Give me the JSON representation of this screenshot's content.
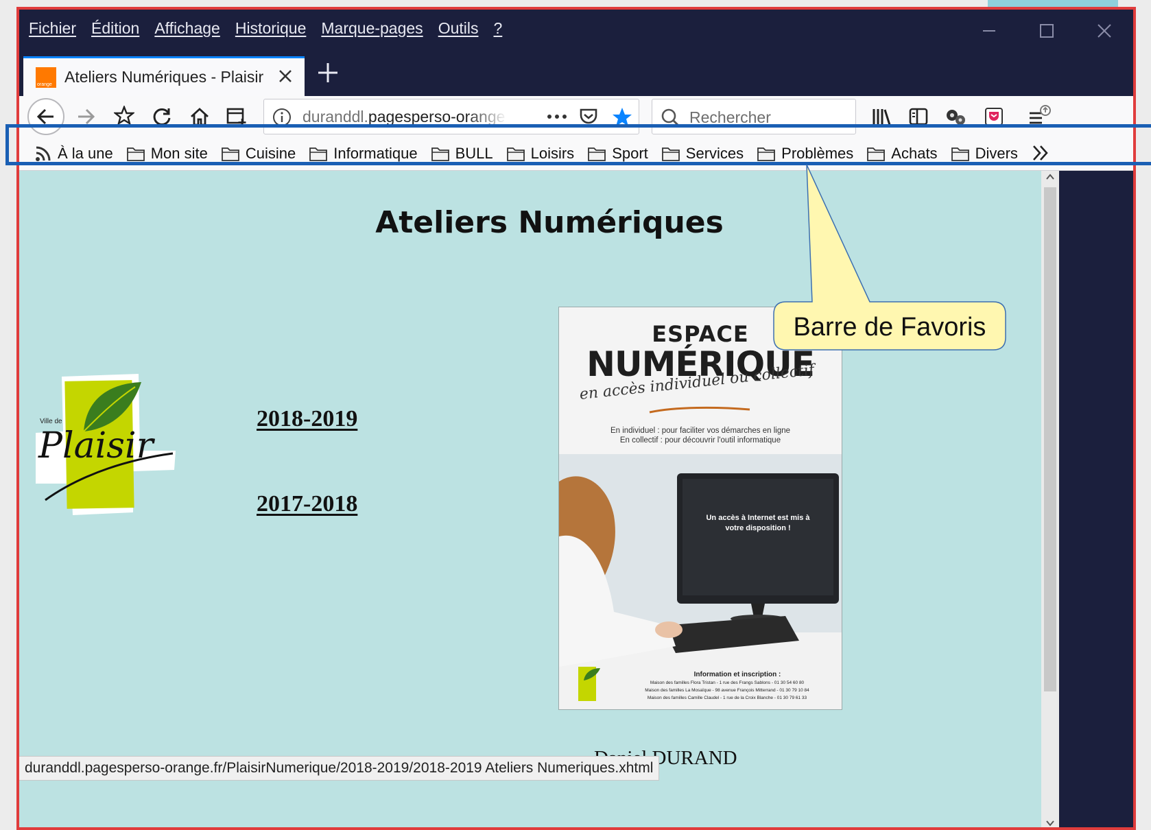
{
  "menu": {
    "items": [
      "Fichier",
      "Édition",
      "Affichage",
      "Historique",
      "Marque-pages",
      "Outils",
      "?"
    ]
  },
  "tab": {
    "title": "Ateliers Numériques - Plaisir",
    "favicon_label": "orange"
  },
  "toolbar": {
    "url_prefix": "duranddl.",
    "url_domain": "pagesperso-orange.fr/PlaisirNumerique/",
    "search_placeholder": "Rechercher"
  },
  "bookmarks": {
    "items": [
      {
        "label": "À la une",
        "icon": "rss-icon"
      },
      {
        "label": "Mon site",
        "icon": "folder-icon"
      },
      {
        "label": "Cuisine",
        "icon": "folder-icon"
      },
      {
        "label": "Informatique",
        "icon": "folder-icon"
      },
      {
        "label": "BULL",
        "icon": "folder-icon"
      },
      {
        "label": "Loisirs",
        "icon": "folder-icon"
      },
      {
        "label": "Sport",
        "icon": "folder-icon"
      },
      {
        "label": "Services",
        "icon": "folder-icon"
      },
      {
        "label": "Problèmes",
        "icon": "folder-icon"
      },
      {
        "label": "Achats",
        "icon": "folder-icon"
      },
      {
        "label": "Divers",
        "icon": "folder-icon"
      }
    ]
  },
  "page": {
    "title": "Ateliers Numériques",
    "logo": {
      "small": "Ville de",
      "name": "Plaisir"
    },
    "links": [
      "2018-2019",
      "2017-2018"
    ],
    "author": "Daniel DURAND"
  },
  "poster": {
    "title_1": "ESPACE",
    "title_2": "NUMÉRIQUE",
    "script": "en accès individuel ou collectif",
    "line_1": "En individuel : pour faciliter vos démarches en ligne",
    "line_2": "En collectif : pour découvrir l'outil informatique",
    "screen_text": "Un accès à Internet est mis à votre disposition !",
    "info_title": "Information et inscription :",
    "info_1": "Maison des familles Flora Tristan - 1 rue des Frangs Sablons - 01 30 54 60 80",
    "info_2": "Maison des familles La Mosaïque - 98 avenue François Mitterrand - 01 30 79 10 84",
    "info_3": "Maison des familles Camille Claudel - 1 rue de la Croix Blanche - 01 30 79 61 33"
  },
  "status": {
    "url": "duranddl.pagesperso-orange.fr/PlaisirNumerique/2018-2019/2018-2019 Ateliers Numeriques.xhtml"
  },
  "annotation": {
    "label": "Barre de Favoris",
    "highlight_color": "#1a5fb4",
    "frame_color": "#e03c3c",
    "callout_fill": "#fff7b0"
  },
  "colors": {
    "titlebar": "#1b1f3d",
    "content_bg": "#bce2e2",
    "accent_blue": "#0a84ff"
  }
}
